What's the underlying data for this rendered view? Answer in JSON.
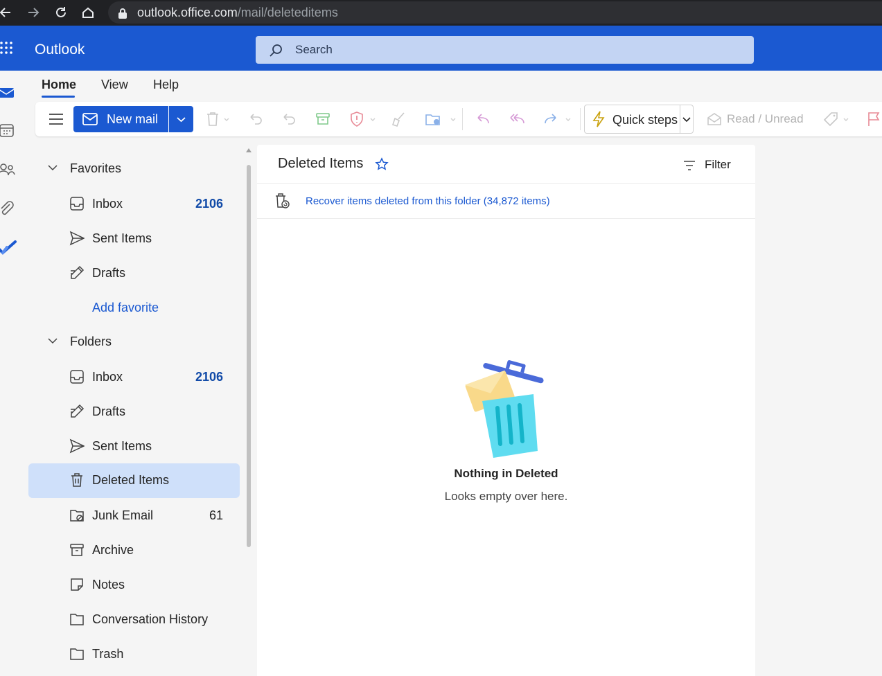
{
  "browser": {
    "url_host": "outlook.office.com",
    "url_path": "/mail/deleteditems"
  },
  "header": {
    "app_name": "Outlook",
    "search_placeholder": "Search"
  },
  "rail": {
    "icons": [
      "mail-icon",
      "calendar-icon",
      "people-icon",
      "attachment-icon",
      "todo-icon"
    ]
  },
  "ribbon": {
    "tabs": [
      {
        "label": "Home",
        "active": true
      },
      {
        "label": "View",
        "active": false
      },
      {
        "label": "Help",
        "active": false
      }
    ]
  },
  "toolbar": {
    "new_mail_label": "New mail",
    "quick_steps_label": "Quick steps",
    "read_unread_label": "Read / Unread"
  },
  "folders": {
    "favorites_label": "Favorites",
    "favorites": [
      {
        "label": "Inbox",
        "count": "2106",
        "icon": "inbox-icon"
      },
      {
        "label": "Sent Items",
        "count": "",
        "icon": "send-icon"
      },
      {
        "label": "Drafts",
        "count": "",
        "icon": "drafts-icon"
      }
    ],
    "add_favorite_label": "Add favorite",
    "folders_label": "Folders",
    "items": [
      {
        "label": "Inbox",
        "count": "2106",
        "icon": "inbox-icon",
        "selected": false
      },
      {
        "label": "Drafts",
        "count": "",
        "icon": "drafts-icon",
        "selected": false
      },
      {
        "label": "Sent Items",
        "count": "",
        "icon": "send-icon",
        "selected": false
      },
      {
        "label": "Deleted Items",
        "count": "",
        "icon": "trash-icon",
        "selected": true
      },
      {
        "label": "Junk Email",
        "count": "61",
        "icon": "junk-icon",
        "selected": false
      },
      {
        "label": "Archive",
        "count": "",
        "icon": "archive-icon",
        "selected": false
      },
      {
        "label": "Notes",
        "count": "",
        "icon": "notes-icon",
        "selected": false
      },
      {
        "label": "Conversation History",
        "count": "",
        "icon": "folder-icon",
        "selected": false
      },
      {
        "label": "Trash",
        "count": "",
        "icon": "folder-icon",
        "selected": false
      }
    ]
  },
  "message_list": {
    "title": "Deleted Items",
    "filter_label": "Filter",
    "recover_link": "Recover items deleted from this folder (34,872 items)",
    "empty_title": "Nothing in Deleted",
    "empty_subtitle": "Looks empty over here."
  },
  "colors": {
    "brand": "#1b59d1",
    "selected_folder": "#cfe0fa",
    "unread_count": "#124ba8"
  }
}
